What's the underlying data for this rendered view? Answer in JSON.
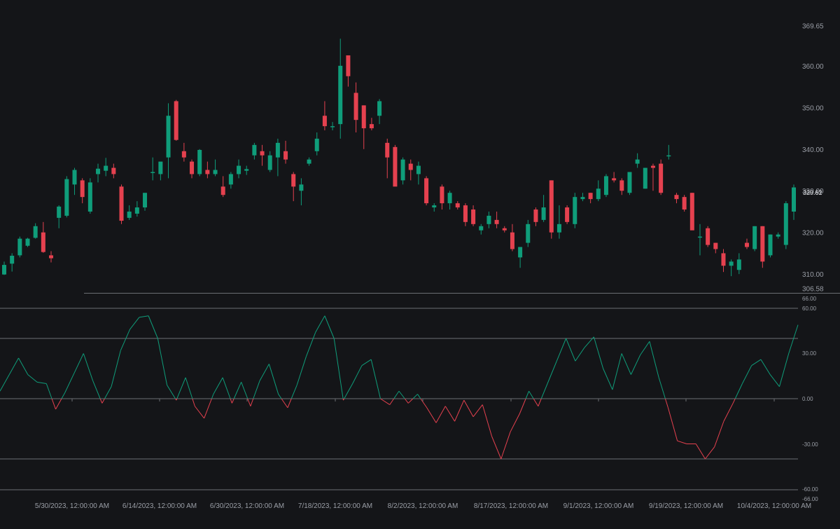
{
  "colors": {
    "background": "#141518",
    "up": "#0f9d7a",
    "down": "#e5414f",
    "grid": "#6b6e73",
    "axis_text": "#9a9ea6",
    "last_price_text": "#d9dbe0"
  },
  "chart_data": [
    {
      "type": "candlestick",
      "y_ticks": [
        "369.65",
        "360.00",
        "350.00",
        "340.00",
        "330.00",
        "320.00",
        "310.00",
        "306.58"
      ],
      "last_price_labels": [
        "329.62",
        "330.81"
      ],
      "ylim": [
        306.58,
        369.65
      ],
      "candles": [
        {
          "o": 309.9,
          "h": 313.0,
          "l": 309.8,
          "c": 312.2
        },
        {
          "o": 312.5,
          "h": 315.0,
          "l": 310.6,
          "c": 314.4
        },
        {
          "o": 314.5,
          "h": 319.0,
          "l": 314.0,
          "c": 318.5
        },
        {
          "o": 316.8,
          "h": 318.7,
          "l": 316.5,
          "c": 318.5
        },
        {
          "o": 318.7,
          "h": 322.2,
          "l": 318.5,
          "c": 321.5
        },
        {
          "o": 320.0,
          "h": 322.5,
          "l": 315.1,
          "c": 315.3
        },
        {
          "o": 314.5,
          "h": 315.5,
          "l": 312.8,
          "c": 313.8
        },
        {
          "o": 323.5,
          "h": 326.5,
          "l": 321.0,
          "c": 326.2
        },
        {
          "o": 324.0,
          "h": 333.5,
          "l": 323.6,
          "c": 332.8
        },
        {
          "o": 331.5,
          "h": 335.5,
          "l": 329.0,
          "c": 335.0
        },
        {
          "o": 332.5,
          "h": 333.0,
          "l": 327.0,
          "c": 328.5
        },
        {
          "o": 325.0,
          "h": 333.0,
          "l": 324.5,
          "c": 332.0
        },
        {
          "o": 334.0,
          "h": 336.5,
          "l": 332.0,
          "c": 335.3
        },
        {
          "o": 334.8,
          "h": 337.9,
          "l": 333.5,
          "c": 336.0
        },
        {
          "o": 335.5,
          "h": 336.5,
          "l": 333.0,
          "c": 334.0
        },
        {
          "o": 331.0,
          "h": 331.5,
          "l": 322.0,
          "c": 322.8
        },
        {
          "o": 323.5,
          "h": 326.5,
          "l": 323.0,
          "c": 325.0
        },
        {
          "o": 324.5,
          "h": 327.5,
          "l": 323.8,
          "c": 326.0
        },
        {
          "o": 326.0,
          "h": 329.5,
          "l": 325.2,
          "c": 329.5
        },
        {
          "o": 334.5,
          "h": 338.0,
          "l": 332.5,
          "c": 334.5
        },
        {
          "o": 334.0,
          "h": 335.5,
          "l": 332.5,
          "c": 337.0
        },
        {
          "o": 338.0,
          "h": 351.0,
          "l": 333.0,
          "c": 348.0
        },
        {
          "o": 351.5,
          "h": 351.8,
          "l": 342.0,
          "c": 342.2
        },
        {
          "o": 339.5,
          "h": 341.5,
          "l": 337.0,
          "c": 338.0
        },
        {
          "o": 337.0,
          "h": 337.5,
          "l": 333.0,
          "c": 334.0
        },
        {
          "o": 334.0,
          "h": 340.0,
          "l": 333.5,
          "c": 339.8
        },
        {
          "o": 335.0,
          "h": 337.0,
          "l": 333.0,
          "c": 334.0
        },
        {
          "o": 334.0,
          "h": 337.5,
          "l": 333.5,
          "c": 335.0
        },
        {
          "o": 331.0,
          "h": 333.5,
          "l": 328.5,
          "c": 329.0
        },
        {
          "o": 331.5,
          "h": 334.5,
          "l": 330.5,
          "c": 334.0
        },
        {
          "o": 334.0,
          "h": 337.5,
          "l": 333.0,
          "c": 336.0
        },
        {
          "o": 334.8,
          "h": 336.0,
          "l": 333.8,
          "c": 335.2
        },
        {
          "o": 338.5,
          "h": 341.5,
          "l": 337.5,
          "c": 341.0
        },
        {
          "o": 339.5,
          "h": 341.0,
          "l": 336.0,
          "c": 338.5
        },
        {
          "o": 335.0,
          "h": 339.5,
          "l": 334.5,
          "c": 338.5
        },
        {
          "o": 338.0,
          "h": 342.5,
          "l": 333.5,
          "c": 341.5
        },
        {
          "o": 339.5,
          "h": 342.0,
          "l": 336.5,
          "c": 337.5
        },
        {
          "o": 334.0,
          "h": 334.5,
          "l": 327.5,
          "c": 331.0
        },
        {
          "o": 330.0,
          "h": 333.0,
          "l": 326.5,
          "c": 331.5
        },
        {
          "o": 336.5,
          "h": 338.0,
          "l": 336.0,
          "c": 337.5
        },
        {
          "o": 339.5,
          "h": 344.0,
          "l": 338.5,
          "c": 342.5
        },
        {
          "o": 348.0,
          "h": 351.5,
          "l": 344.5,
          "c": 345.5
        },
        {
          "o": 345.5,
          "h": 346.5,
          "l": 344.5,
          "c": 345.5
        },
        {
          "o": 346.0,
          "h": 366.5,
          "l": 342.5,
          "c": 360.0
        },
        {
          "o": 362.5,
          "h": 362.5,
          "l": 355.0,
          "c": 357.5
        },
        {
          "o": 353.5,
          "h": 356.0,
          "l": 344.0,
          "c": 347.0
        },
        {
          "o": 350.5,
          "h": 350.5,
          "l": 340.0,
          "c": 345.0
        },
        {
          "o": 346.0,
          "h": 347.5,
          "l": 344.5,
          "c": 345.0
        },
        {
          "o": 348.0,
          "h": 352.0,
          "l": 346.0,
          "c": 351.5
        },
        {
          "o": 341.5,
          "h": 342.5,
          "l": 333.0,
          "c": 338.0
        },
        {
          "o": 340.5,
          "h": 341.0,
          "l": 331.5,
          "c": 331.0
        },
        {
          "o": 332.5,
          "h": 338.0,
          "l": 331.5,
          "c": 337.5
        },
        {
          "o": 336.5,
          "h": 337.5,
          "l": 332.5,
          "c": 335.0
        },
        {
          "o": 334.0,
          "h": 337.0,
          "l": 331.5,
          "c": 336.0
        },
        {
          "o": 333.0,
          "h": 333.5,
          "l": 326.5,
          "c": 327.0
        },
        {
          "o": 326.0,
          "h": 327.0,
          "l": 325.0,
          "c": 326.5
        },
        {
          "o": 331.0,
          "h": 331.5,
          "l": 325.5,
          "c": 327.0
        },
        {
          "o": 327.0,
          "h": 330.0,
          "l": 325.5,
          "c": 329.5
        },
        {
          "o": 327.0,
          "h": 327.5,
          "l": 325.5,
          "c": 326.0
        },
        {
          "o": 326.5,
          "h": 327.0,
          "l": 321.5,
          "c": 322.5
        },
        {
          "o": 325.5,
          "h": 326.5,
          "l": 321.5,
          "c": 322.0
        },
        {
          "o": 320.5,
          "h": 322.0,
          "l": 319.5,
          "c": 321.5
        },
        {
          "o": 322.0,
          "h": 325.0,
          "l": 321.0,
          "c": 324.0
        },
        {
          "o": 323.0,
          "h": 325.0,
          "l": 321.0,
          "c": 322.0
        },
        {
          "o": 321.0,
          "h": 321.5,
          "l": 320.0,
          "c": 320.5
        },
        {
          "o": 320.0,
          "h": 322.0,
          "l": 315.5,
          "c": 316.0
        },
        {
          "o": 314.0,
          "h": 316.5,
          "l": 311.5,
          "c": 316.5
        },
        {
          "o": 317.5,
          "h": 323.0,
          "l": 316.5,
          "c": 322.0
        },
        {
          "o": 325.5,
          "h": 326.0,
          "l": 321.5,
          "c": 322.5
        },
        {
          "o": 323.0,
          "h": 329.0,
          "l": 322.5,
          "c": 326.0
        },
        {
          "o": 332.5,
          "h": 332.5,
          "l": 318.5,
          "c": 320.0
        },
        {
          "o": 320.0,
          "h": 326.5,
          "l": 318.5,
          "c": 322.0
        },
        {
          "o": 326.0,
          "h": 326.5,
          "l": 322.0,
          "c": 322.5
        },
        {
          "o": 322.0,
          "h": 329.5,
          "l": 321.0,
          "c": 328.5
        },
        {
          "o": 328.0,
          "h": 329.5,
          "l": 327.5,
          "c": 328.5
        },
        {
          "o": 329.5,
          "h": 329.5,
          "l": 327.0,
          "c": 328.0
        },
        {
          "o": 328.0,
          "h": 332.5,
          "l": 327.5,
          "c": 330.5
        },
        {
          "o": 329.0,
          "h": 334.0,
          "l": 328.5,
          "c": 333.5
        },
        {
          "o": 333.0,
          "h": 334.5,
          "l": 332.0,
          "c": 332.5
        },
        {
          "o": 332.5,
          "h": 333.0,
          "l": 329.0,
          "c": 330.0
        },
        {
          "o": 329.5,
          "h": 334.0,
          "l": 329.0,
          "c": 334.5
        },
        {
          "o": 336.5,
          "h": 339.0,
          "l": 335.5,
          "c": 337.5
        },
        {
          "o": 330.5,
          "h": 335.5,
          "l": 330.5,
          "c": 335.5
        },
        {
          "o": 336.0,
          "h": 336.5,
          "l": 330.0,
          "c": 335.5
        },
        {
          "o": 336.5,
          "h": 337.5,
          "l": 329.0,
          "c": 329.5
        },
        {
          "o": 338.5,
          "h": 341.0,
          "l": 337.5,
          "c": 338.5
        },
        {
          "o": 329.0,
          "h": 329.5,
          "l": 327.0,
          "c": 328.0
        },
        {
          "o": 328.5,
          "h": 329.0,
          "l": 325.0,
          "c": 325.5
        },
        {
          "o": 329.5,
          "h": 329.5,
          "l": 321.0,
          "c": 320.5
        },
        {
          "o": 319.0,
          "h": 322.0,
          "l": 314.5,
          "c": 319.0
        },
        {
          "o": 321.0,
          "h": 321.5,
          "l": 316.5,
          "c": 317.0
        },
        {
          "o": 317.5,
          "h": 317.5,
          "l": 315.0,
          "c": 316.0
        },
        {
          "o": 315.0,
          "h": 316.0,
          "l": 310.5,
          "c": 312.0
        },
        {
          "o": 312.0,
          "h": 313.5,
          "l": 309.5,
          "c": 313.0
        },
        {
          "o": 311.0,
          "h": 315.0,
          "l": 310.0,
          "c": 313.5
        },
        {
          "o": 317.5,
          "h": 318.5,
          "l": 316.0,
          "c": 316.5
        },
        {
          "o": 316.0,
          "h": 321.5,
          "l": 315.5,
          "c": 321.5
        },
        {
          "o": 321.5,
          "h": 321.5,
          "l": 311.5,
          "c": 313.0
        },
        {
          "o": 314.5,
          "h": 319.5,
          "l": 314.0,
          "c": 319.5
        },
        {
          "o": 319.0,
          "h": 320.0,
          "l": 318.5,
          "c": 319.5
        },
        {
          "o": 317.0,
          "h": 327.5,
          "l": 316.0,
          "c": 327.0
        },
        {
          "o": 325.0,
          "h": 331.5,
          "l": 323.0,
          "c": 330.8
        }
      ]
    },
    {
      "type": "line",
      "y_ticks": [
        "66.00",
        "60.00",
        "30.00",
        "0.00",
        "-30.00",
        "-60.00",
        "-66.00"
      ],
      "ylim": [
        -66,
        66
      ],
      "reference_lines": [
        60,
        40,
        0,
        -40
      ],
      "values": [
        5,
        16,
        27,
        16,
        11,
        10,
        -7,
        4,
        17,
        30,
        12,
        -3,
        8,
        32,
        46,
        54,
        55,
        40,
        9,
        -1,
        14,
        -5,
        -13,
        3,
        14,
        -3,
        11,
        -5,
        12,
        23,
        3,
        -6,
        9,
        28,
        44,
        55,
        40,
        -1,
        10,
        22,
        26,
        0,
        -4,
        5,
        -3,
        3,
        -6,
        -16,
        -5,
        -15,
        -1,
        -12,
        -4,
        -25,
        -40,
        -22,
        -10,
        5,
        -5,
        10,
        25,
        40,
        25,
        34,
        41,
        20,
        6,
        30,
        16,
        29,
        38,
        14,
        -6,
        -28,
        -30,
        -30,
        -40,
        -32,
        -15,
        -3,
        10,
        22,
        26,
        16,
        8,
        30,
        49
      ]
    }
  ],
  "x_axis": {
    "labels": [
      "5/30/2023, 12:00:00 AM",
      "6/14/2023, 12:00:00 AM",
      "6/30/2023, 12:00:00 AM",
      "7/18/2023, 12:00:00 AM",
      "8/2/2023, 12:00:00 AM",
      "8/17/2023, 12:00:00 AM",
      "9/1/2023, 12:00:00 AM",
      "9/19/2023, 12:00:00 AM",
      "10/4/2023, 12:00:00 AM"
    ]
  }
}
